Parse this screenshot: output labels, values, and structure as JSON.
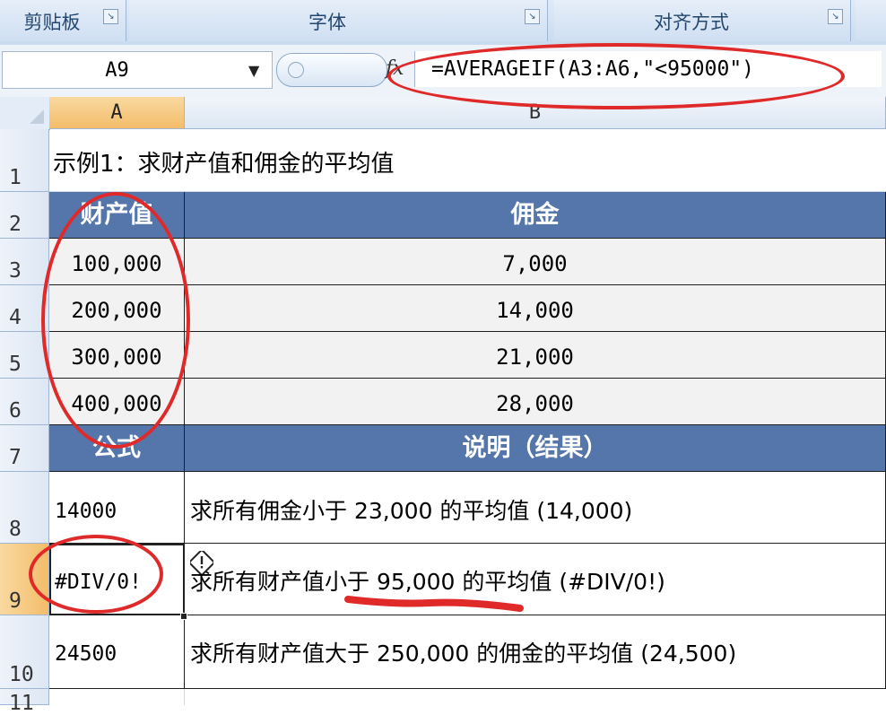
{
  "ribbon": {
    "groups": [
      {
        "label": "剪贴板",
        "launcher_icon": "dialog-launcher-icon"
      },
      {
        "label": "字体",
        "launcher_icon": "dialog-launcher-icon"
      },
      {
        "label": "对齐方式",
        "launcher_icon": "dialog-launcher-icon"
      }
    ]
  },
  "formula_bar": {
    "name_box": "A9",
    "fx_label": "fx",
    "formula": "=AVERAGEIF(A3:A6,\"<95000\")"
  },
  "grid": {
    "columns": [
      "A",
      "B"
    ],
    "selected_column": "A",
    "rows": [
      "1",
      "2",
      "3",
      "4",
      "5",
      "6",
      "7",
      "8",
      "9",
      "10",
      "11"
    ],
    "selected_row": "9",
    "title": "示例1：求财产值和佣金的平均值",
    "table_header": {
      "a": "财产值",
      "b": "佣金"
    },
    "data_rows": [
      {
        "a": "100,000",
        "b": "7,000"
      },
      {
        "a": "200,000",
        "b": "14,000"
      },
      {
        "a": "300,000",
        "b": "21,000"
      },
      {
        "a": "400,000",
        "b": "28,000"
      }
    ],
    "formula_header": {
      "a": "公式",
      "b": "说明（结果）"
    },
    "formula_rows": [
      {
        "a": "14000",
        "b": "求所有佣金小于 23,000 的平均值 (14,000)"
      },
      {
        "a": "#DIV/0!",
        "b": "求所有财产值小于 95,000 的平均值 (#DIV/0!)"
      },
      {
        "a": "24500",
        "b": "求所有财产值大于 250,000 的佣金的平均值 (24,500)"
      }
    ],
    "active_cell": "A9"
  },
  "annotations": {
    "color": "#e02a2a",
    "items": [
      "formula-circle",
      "property-values-circle",
      "div0-circle",
      "underline"
    ]
  },
  "colors": {
    "header_fill": "#5476ab",
    "data_fill": "#f2f2f2",
    "selected_header": "#f3bd6a"
  }
}
